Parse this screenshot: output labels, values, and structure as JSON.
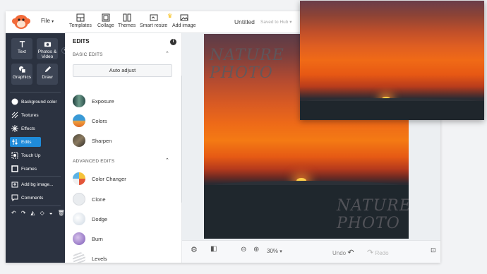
{
  "topbar": {
    "file_label": "File",
    "tools": [
      {
        "label": "Templates",
        "icon": "templates-icon"
      },
      {
        "label": "Collage",
        "icon": "collage-icon"
      },
      {
        "label": "Themes",
        "icon": "themes-icon"
      },
      {
        "label": "Smart resize",
        "icon": "smart-resize-icon"
      },
      {
        "label": "Add image",
        "icon": "add-image-icon"
      }
    ],
    "doc_title": "Untitled",
    "saved_status": "Saved to Hub"
  },
  "rail": {
    "tiles": [
      {
        "label": "Text",
        "icon": "text-icon"
      },
      {
        "label": "Photos & Video",
        "icon": "camera-icon"
      },
      {
        "label": "Graphics",
        "icon": "graphics-icon"
      },
      {
        "label": "Draw",
        "icon": "pencil-icon"
      }
    ],
    "items": [
      {
        "label": "Background color",
        "icon": "background-color-icon"
      },
      {
        "label": "Textures",
        "icon": "textures-icon"
      },
      {
        "label": "Effects",
        "icon": "effects-icon"
      },
      {
        "label": "Edits",
        "icon": "sliders-icon"
      },
      {
        "label": "Touch Up",
        "icon": "touch-up-icon"
      },
      {
        "label": "Frames",
        "icon": "frames-icon"
      },
      {
        "label": "Add bg image...",
        "icon": "add-bg-image-icon"
      },
      {
        "label": "Comments",
        "icon": "comments-icon"
      }
    ]
  },
  "panel": {
    "title": "EDITS",
    "basic_header": "BASIC EDITS",
    "auto_adjust": "Auto adjust",
    "basic_items": [
      "Exposure",
      "Colors",
      "Sharpen"
    ],
    "advanced_header": "ADVANCED EDITS",
    "advanced_items": [
      "Color Changer",
      "Clone",
      "Dodge",
      "Burn",
      "Levels"
    ]
  },
  "canvas": {
    "text_top_line1": "NATURE",
    "text_top_line2": "PHOTO",
    "text_bottom_line1": "NATURE",
    "text_bottom_line2": "PHOTO"
  },
  "bottombar": {
    "zoom": "30%",
    "undo": "Undo",
    "redo": "Redo"
  },
  "colors": {
    "rail_bg": "#2b3240",
    "accent": "#1f8bd9"
  }
}
